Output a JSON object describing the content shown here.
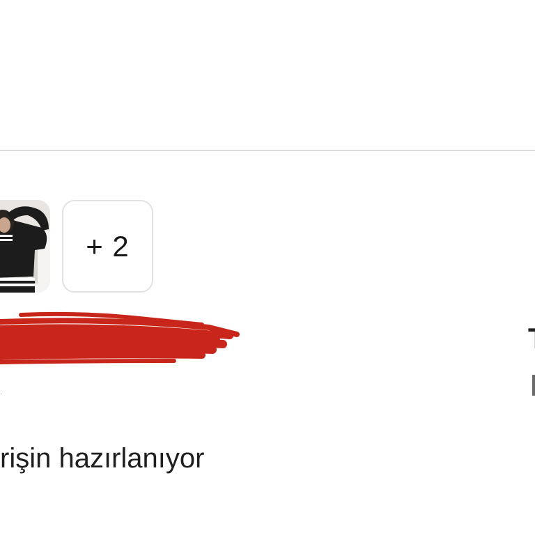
{
  "product_images": {
    "more_count_label": "+ 2",
    "thumbnail_alt": "product photo: person wearing black striped sweater"
  },
  "order": {
    "status": "rişin hazırlanıyor"
  },
  "edge": {
    "right_char": "T"
  },
  "colors": {
    "redaction_red": "#c8261a",
    "divider": "#dcdcdc",
    "tile_border": "#e2e2e2"
  }
}
